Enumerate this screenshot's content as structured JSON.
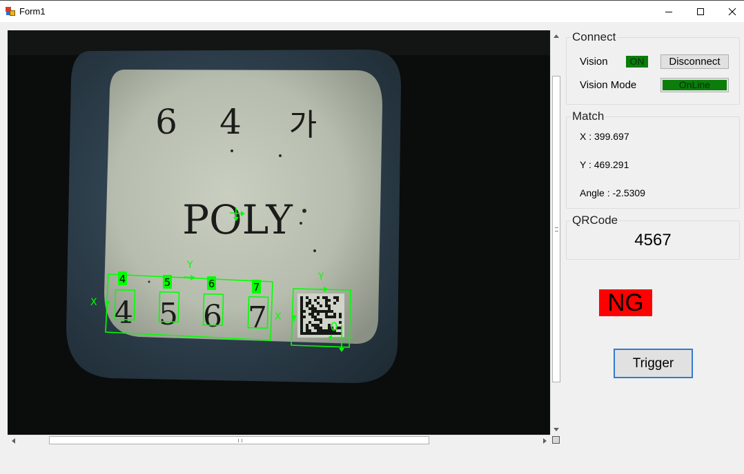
{
  "window": {
    "title": "Form1",
    "controls": [
      "minimize-icon",
      "maximize-icon",
      "close-icon"
    ]
  },
  "image_view": {
    "card_text": {
      "line1": [
        "6",
        "4",
        "가"
      ],
      "line2": "POLY",
      "line3": [
        "4",
        "5",
        "6",
        "7"
      ]
    },
    "ocr_labels": [
      "4",
      "5",
      "6",
      "7"
    ],
    "axis_labels": {
      "x": "X",
      "y": "Y"
    },
    "qr_label": "0",
    "overlay_color": "#00ff00"
  },
  "connect": {
    "legend": "Connect",
    "vision_label": "Vision",
    "vision_status": "ON",
    "disconnect_label": "Disconnect",
    "mode_label": "Vision Mode",
    "mode_value": "OnLine"
  },
  "match": {
    "legend": "Match",
    "x_text": "X : 399.697",
    "y_text": "Y : 469.291",
    "angle_text": "Angle : -2.5309"
  },
  "qrcode": {
    "legend": "QRCode",
    "value": "4567"
  },
  "result": {
    "status": "NG",
    "status_color": "#ff0000"
  },
  "trigger": {
    "label": "Trigger"
  }
}
